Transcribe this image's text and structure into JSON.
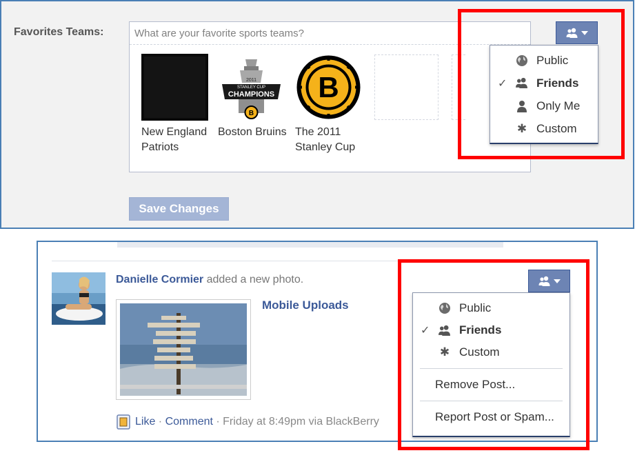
{
  "profile_section": {
    "label": "Favorites Teams:",
    "input_placeholder": "What are your favorite sports teams?",
    "teams": [
      {
        "name": "New England Patriots"
      },
      {
        "name": "Boston Bruins"
      },
      {
        "name": "The 2011 Stanley Cup"
      }
    ],
    "stanley_cup_logo_text": [
      "2011",
      "STANLEY CUP",
      "CHAMPIONS"
    ],
    "save_button": "Save Changes",
    "privacy_menu": {
      "items": [
        {
          "label": "Public",
          "icon": "globe-icon",
          "checked": false
        },
        {
          "label": "Friends",
          "icon": "friends-icon",
          "checked": true
        },
        {
          "label": "Only Me",
          "icon": "person-icon",
          "checked": false
        },
        {
          "label": "Custom",
          "icon": "gear-icon",
          "checked": false
        }
      ]
    }
  },
  "feed_section": {
    "author": "Danielle Cormier",
    "action": " added a new photo.",
    "album": "Mobile Uploads",
    "footer": {
      "like": "Like",
      "comment": "Comment",
      "meta": " · Friday at 8:49pm via BlackBerry",
      "sep": " · "
    },
    "privacy_menu": {
      "items": [
        {
          "label": "Public",
          "icon": "globe-icon",
          "checked": false
        },
        {
          "label": "Friends",
          "icon": "friends-icon",
          "checked": true
        },
        {
          "label": "Custom",
          "icon": "gear-icon",
          "checked": false
        }
      ],
      "actions": [
        {
          "label": "Remove Post..."
        },
        {
          "label": "Report Post or Spam..."
        }
      ]
    }
  },
  "colors": {
    "highlight_box": "#ff0000",
    "facebook_blue": "#3b5998",
    "panel_border": "#4a7fb5"
  }
}
